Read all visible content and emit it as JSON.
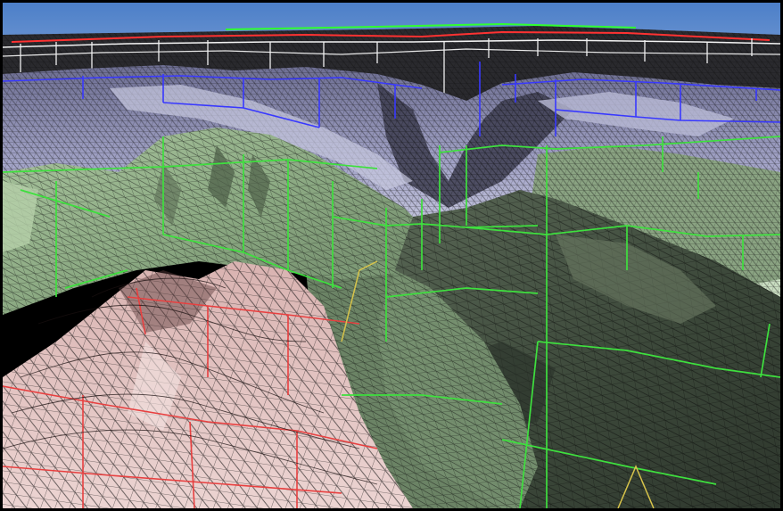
{
  "scene": {
    "kind": "3d-terrain-wireframe-render",
    "colors": {
      "sky": "#5b86c9",
      "far_ridge_white": "#e8e8e8",
      "ridge_red": "#ff3030",
      "ridge_green": "#30ff30",
      "mid_lavender": "#a7a8cc",
      "mid_blue_lines": "#3b3bff",
      "green_terrain": "#97b08f",
      "dark_terrain": "#3e4a3c",
      "pink_foreground": "#e3c4c3",
      "bound_green": "#40e040",
      "bound_red": "#e83a3a",
      "bound_yellow": "#d9c34a",
      "mesh_black": "#101010"
    },
    "layers": [
      "sky",
      "far-ridge",
      "mid-canyon",
      "green-slopes",
      "dark-valley",
      "pink-foreground"
    ]
  }
}
